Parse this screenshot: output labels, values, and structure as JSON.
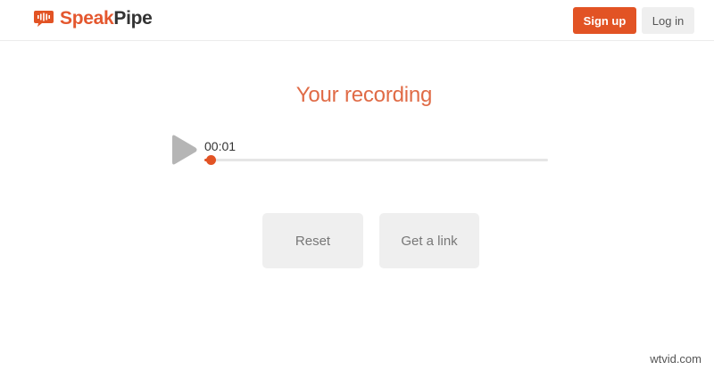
{
  "header": {
    "logo_part1": "Speak",
    "logo_part2": "Pipe",
    "signup_label": "Sign up",
    "login_label": "Log in"
  },
  "main": {
    "title": "Your recording",
    "player": {
      "time": "00:01",
      "progress_fraction": 0.01
    },
    "reset_label": "Reset",
    "get_link_label": "Get a link"
  },
  "watermark": "wtvid.com",
  "colors": {
    "brand": "#e25324",
    "title": "#e06b46",
    "button_bg": "#efefef",
    "play_icon": "#b5b5b5"
  },
  "icons": {
    "logo": "speakpipe-waveform-bubble-icon",
    "play": "play-icon"
  }
}
